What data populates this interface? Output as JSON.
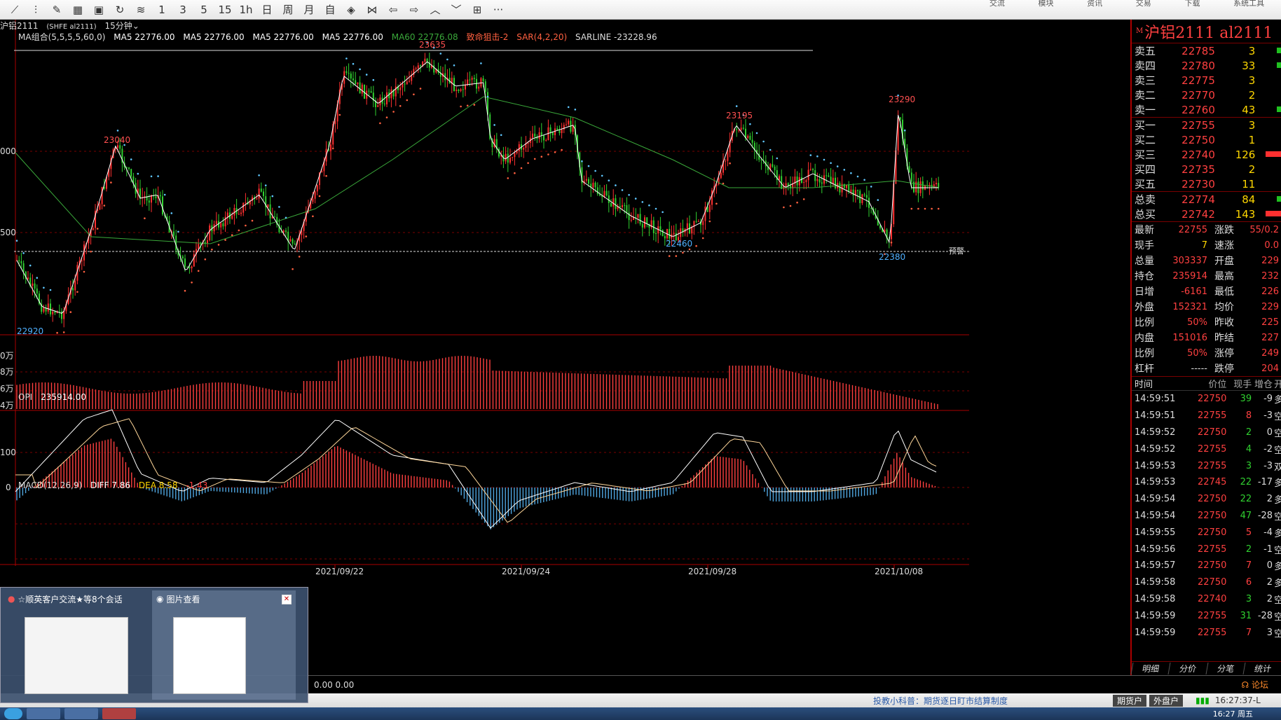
{
  "toolbar": {
    "icons": [
      "line-chart-icon",
      "candle-icon",
      "brush-icon",
      "grid-icon",
      "save-icon",
      "refresh-icon",
      "compare-icon"
    ],
    "periods": [
      "1",
      "3",
      "5",
      "15",
      "1h",
      "日",
      "周",
      "月",
      "自"
    ],
    "nav_icons": [
      "diamond-icon",
      "first-icon",
      "prev-icon",
      "next-icon",
      "up-icon",
      "down-icon",
      "layout-icon"
    ],
    "more": "···",
    "right_menu": [
      "交流",
      "模块",
      "资讯",
      "交易",
      "下载",
      "系统工具"
    ]
  },
  "chart": {
    "symbol_header": "沪铝2111",
    "symbol_sub": "(SHFE al2111)",
    "period": "15分钟",
    "ma_group": "MA组合(5,5,5,5,60,0)",
    "ma_items": [
      "MA5 22776.00",
      "MA5 22776.00",
      "MA5 22776.00",
      "MA5 22776.00"
    ],
    "ma60": "MA60 22776.08",
    "signal": "致命狙击-2",
    "sar": "SAR(4,2,20)",
    "sarline": "SARLINE -23228.96",
    "peak_labels": [
      "23635",
      "23040",
      "23195",
      "23290",
      "22460",
      "22380",
      "22920"
    ],
    "y_labels_main": [
      "000",
      "500"
    ],
    "alert_label": "预警",
    "opi_label": "OPI",
    "opi_value": "235914.00",
    "opi_axis": [
      "0万",
      "8万",
      "6万",
      "4万"
    ],
    "macd_label": "MACD(12,26,9)",
    "macd_diff": "DIFF 7.86",
    "macd_dea": "DEA 8.58",
    "macd_val": "-1.43",
    "macd_axis": [
      "100",
      "0"
    ],
    "dates": [
      "2021/09/22",
      "2021/09/24",
      "2021/09/28",
      "2021/10/08"
    ],
    "colors": {
      "up": "#ff3030",
      "down": "#30d030",
      "ma5": "#ffffff",
      "ma60": "#3aa83a",
      "sar": "#ff6040",
      "sar_down": "#60c8ff",
      "grid": "#7a0000"
    }
  },
  "right_panel": {
    "title": "沪铝2111  al2111",
    "badge": "M",
    "asks": [
      {
        "label": "卖五",
        "price": "22785",
        "vol": "3",
        "bar": "down"
      },
      {
        "label": "卖四",
        "price": "22780",
        "vol": "33",
        "bar": "down"
      },
      {
        "label": "卖三",
        "price": "22775",
        "vol": "3",
        "bar": "none"
      },
      {
        "label": "卖二",
        "price": "22770",
        "vol": "2",
        "bar": "none"
      },
      {
        "label": "卖一",
        "price": "22760",
        "vol": "43",
        "bar": "down"
      }
    ],
    "bids": [
      {
        "label": "买一",
        "price": "22755",
        "vol": "3",
        "bar": "none"
      },
      {
        "label": "买二",
        "price": "22750",
        "vol": "1",
        "bar": "none"
      },
      {
        "label": "买三",
        "price": "22740",
        "vol": "126",
        "bar": "up"
      },
      {
        "label": "买四",
        "price": "22735",
        "vol": "2",
        "bar": "none"
      },
      {
        "label": "买五",
        "price": "22730",
        "vol": "11",
        "bar": "none"
      }
    ],
    "totals": [
      {
        "label": "总卖",
        "price": "22774",
        "vol": "84",
        "bar": "down"
      },
      {
        "label": "总买",
        "price": "22742",
        "vol": "143",
        "bar": "up"
      }
    ],
    "stats": [
      {
        "l1": "最新",
        "v1": "22755",
        "l2": "涨跌",
        "v2": "55/0.2"
      },
      {
        "l1": "现手",
        "v1": "7",
        "l2": "速涨",
        "v2": "0.0"
      },
      {
        "l1": "总量",
        "v1": "303337",
        "l2": "开盘",
        "v2": "229"
      },
      {
        "l1": "持仓",
        "v1": "235914",
        "l2": "最高",
        "v2": "232"
      },
      {
        "l1": "日增",
        "v1": "-6161",
        "l2": "最低",
        "v2": "226"
      },
      {
        "l1": "外盘",
        "v1": "152321",
        "l2": "均价",
        "v2": "229"
      },
      {
        "l1": "比例",
        "v1": "50%",
        "l2": "昨收",
        "v2": "225"
      },
      {
        "l1": "内盘",
        "v1": "151016",
        "l2": "昨结",
        "v2": "227"
      },
      {
        "l1": "比例",
        "v1": "50%",
        "l2": "涨停",
        "v2": "249"
      },
      {
        "l1": "杠杆",
        "v1": "-----",
        "l2": "跌停",
        "v2": "204"
      }
    ],
    "tick_head": [
      "时间",
      "价位",
      "现手",
      "增仓",
      "开"
    ],
    "ticks": [
      {
        "t": "14:59:51",
        "p": "22750",
        "v": "39",
        "c": "-9",
        "n": "多"
      },
      {
        "t": "14:59:51",
        "p": "22755",
        "v": "8",
        "c": "-3",
        "n": "空"
      },
      {
        "t": "14:59:52",
        "p": "22750",
        "v": "2",
        "c": "0",
        "n": "空"
      },
      {
        "t": "14:59:52",
        "p": "22755",
        "v": "4",
        "c": "-2",
        "n": "空"
      },
      {
        "t": "14:59:53",
        "p": "22755",
        "v": "3",
        "c": "-3",
        "n": "双"
      },
      {
        "t": "14:59:53",
        "p": "22745",
        "v": "22",
        "c": "-17",
        "n": "多"
      },
      {
        "t": "14:59:54",
        "p": "22750",
        "v": "22",
        "c": "2",
        "n": "多"
      },
      {
        "t": "14:59:54",
        "p": "22750",
        "v": "47",
        "c": "-28",
        "n": "空"
      },
      {
        "t": "14:59:55",
        "p": "22750",
        "v": "5",
        "c": "-4",
        "n": "多"
      },
      {
        "t": "14:59:56",
        "p": "22755",
        "v": "2",
        "c": "-1",
        "n": "空"
      },
      {
        "t": "14:59:57",
        "p": "22750",
        "v": "7",
        "c": "0",
        "n": "多"
      },
      {
        "t": "14:59:58",
        "p": "22750",
        "v": "6",
        "c": "2",
        "n": "多"
      },
      {
        "t": "14:59:58",
        "p": "22740",
        "v": "3",
        "c": "2",
        "n": "空"
      },
      {
        "t": "14:59:59",
        "p": "22755",
        "v": "31",
        "c": "-28",
        "n": "空"
      },
      {
        "t": "14:59:59",
        "p": "22755",
        "v": "7",
        "c": "3",
        "n": "空"
      }
    ],
    "tabs": [
      "明细",
      "分价",
      "分笔",
      "统计"
    ]
  },
  "status": {
    "values": "0.00  0.00",
    "tip": "投教小科普：期货逐日盯市结算制度",
    "btn_futures": "期货户",
    "btn_external": "外盘户",
    "time": "16:27:37-L",
    "forum": "论坛"
  },
  "taskbar": {
    "clock": "16:27 周五"
  },
  "preview": {
    "card1_title": "☆顺英客户交流★等8个会话",
    "card2_title": "图片查看",
    "close": "✕"
  }
}
